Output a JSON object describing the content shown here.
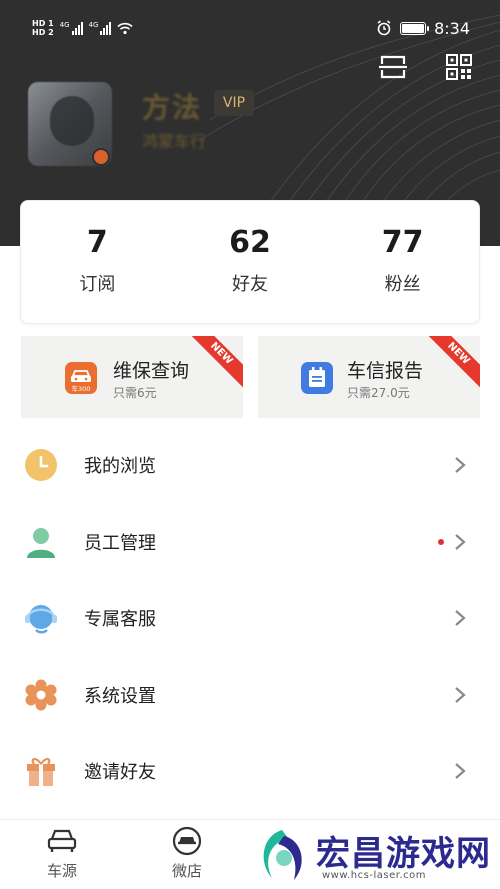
{
  "status_bar": {
    "hd1": "HD 1",
    "hd2": "HD 2",
    "net1": "4G",
    "net2": "4G",
    "time": "8:34"
  },
  "profile": {
    "name": "方法",
    "vip": "VIP",
    "subtitle": "鸿蒙车行"
  },
  "stats": [
    {
      "value": "7",
      "label": "订阅"
    },
    {
      "value": "62",
      "label": "好友"
    },
    {
      "value": "77",
      "label": "粉丝"
    }
  ],
  "services": [
    {
      "title": "维保查询",
      "subtitle": "只需6元",
      "ribbon": "NEW",
      "icon_text": "车300",
      "icon": "car300-icon",
      "color": "#ea6e30"
    },
    {
      "title": "车信报告",
      "subtitle": "只需27.0元",
      "ribbon": "NEW",
      "icon": "report-icon",
      "color": "#3f7be0"
    }
  ],
  "menu": [
    {
      "label": "我的浏览",
      "icon": "clock-icon"
    },
    {
      "label": "员工管理",
      "icon": "person-icon",
      "has_dot": true
    },
    {
      "label": "专属客服",
      "icon": "headset-icon"
    },
    {
      "label": "系统设置",
      "icon": "gear-icon"
    },
    {
      "label": "邀请好友",
      "icon": "gift-icon"
    }
  ],
  "tabs": [
    {
      "label": "车源",
      "icon": "car-icon"
    },
    {
      "label": "微店",
      "icon": "shop-icon"
    }
  ],
  "watermark": {
    "text": "宏昌游戏网",
    "url": "www.hcs-laser.com"
  },
  "colors": {
    "header_bg": "#2f2f2f",
    "vip_gold": "#d7b473",
    "ribbon_red": "#e5392e",
    "watermark_blue": "#2c2a8f"
  }
}
